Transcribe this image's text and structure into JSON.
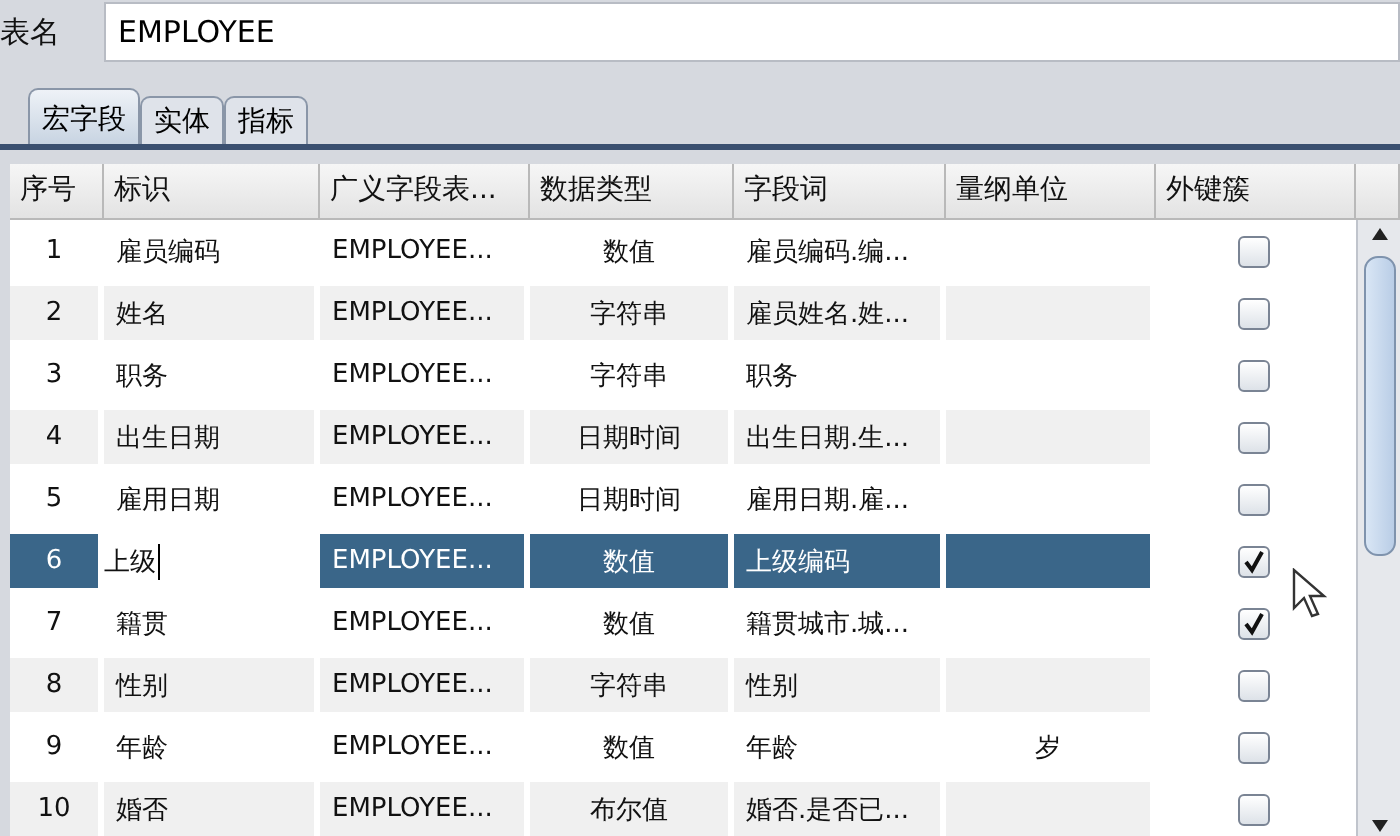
{
  "table_name": {
    "label": "表名",
    "value": "EMPLOYEE"
  },
  "tabs": [
    {
      "label": "宏字段",
      "selected": true
    },
    {
      "label": "实体",
      "selected": false
    },
    {
      "label": "指标",
      "selected": false
    }
  ],
  "table": {
    "columns": [
      "序号",
      "标识",
      "广义字段表...",
      "数据类型",
      "字段词",
      "量纲单位",
      "外键簇"
    ],
    "rows": [
      {
        "no": "1",
        "id": "雇员编码",
        "table": "EMPLOYEE...",
        "type": "数值",
        "word": "雇员编码.编...",
        "unit": "",
        "fk": false,
        "selected": false,
        "editing": false
      },
      {
        "no": "2",
        "id": "姓名",
        "table": "EMPLOYEE...",
        "type": "字符串",
        "word": "雇员姓名.姓...",
        "unit": "",
        "fk": false,
        "selected": false,
        "editing": false
      },
      {
        "no": "3",
        "id": "职务",
        "table": "EMPLOYEE...",
        "type": "字符串",
        "word": "职务",
        "unit": "",
        "fk": false,
        "selected": false,
        "editing": false
      },
      {
        "no": "4",
        "id": "出生日期",
        "table": "EMPLOYEE...",
        "type": "日期时间",
        "word": "出生日期.生...",
        "unit": "",
        "fk": false,
        "selected": false,
        "editing": false
      },
      {
        "no": "5",
        "id": "雇用日期",
        "table": "EMPLOYEE...",
        "type": "日期时间",
        "word": "雇用日期.雇...",
        "unit": "",
        "fk": false,
        "selected": false,
        "editing": false
      },
      {
        "no": "6",
        "id": "上级",
        "table": "EMPLOYEE...",
        "type": "数值",
        "word": "上级编码",
        "unit": "",
        "fk": true,
        "selected": true,
        "editing": true
      },
      {
        "no": "7",
        "id": "籍贯",
        "table": "EMPLOYEE...",
        "type": "数值",
        "word": "籍贯城市.城...",
        "unit": "",
        "fk": true,
        "selected": false,
        "editing": false
      },
      {
        "no": "8",
        "id": "性别",
        "table": "EMPLOYEE...",
        "type": "字符串",
        "word": "性别",
        "unit": "",
        "fk": false,
        "selected": false,
        "editing": false
      },
      {
        "no": "9",
        "id": "年龄",
        "table": "EMPLOYEE...",
        "type": "数值",
        "word": "年龄",
        "unit": "岁",
        "fk": false,
        "selected": false,
        "editing": false
      },
      {
        "no": "10",
        "id": "婚否",
        "table": "EMPLOYEE...",
        "type": "布尔值",
        "word": "婚否.是否已...",
        "unit": "",
        "fk": false,
        "selected": false,
        "editing": false
      }
    ]
  }
}
